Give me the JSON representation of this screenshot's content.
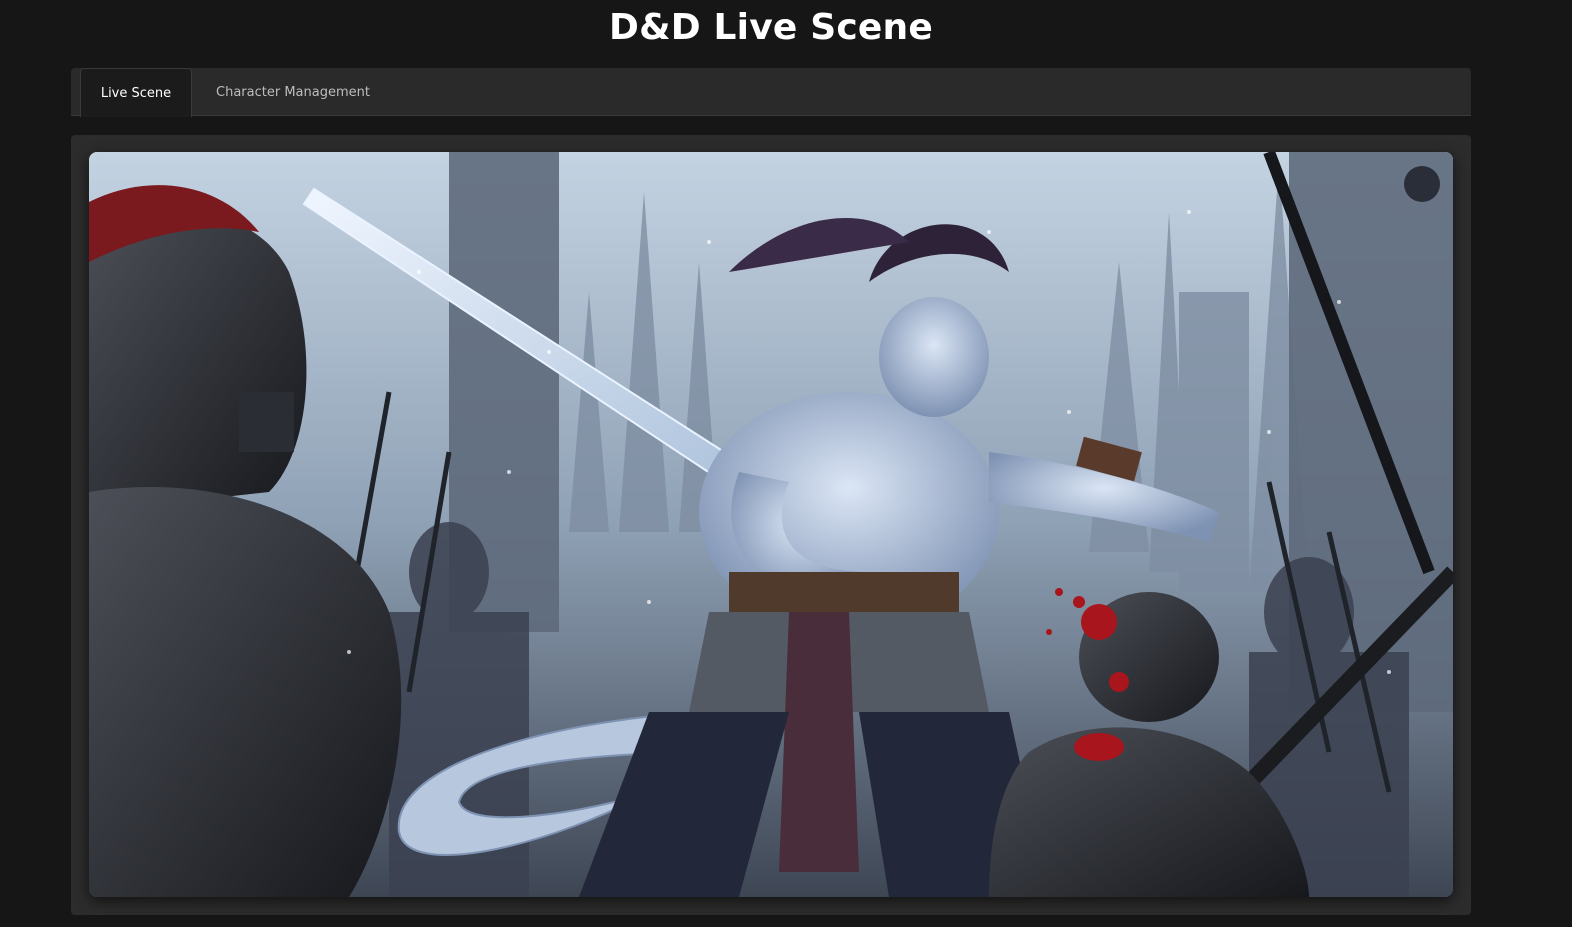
{
  "app": {
    "title": "D&D Live Scene"
  },
  "tabs": [
    {
      "label": "Live Scene",
      "active": true
    },
    {
      "label": "Character Management",
      "active": false
    }
  ],
  "scene": {
    "image_subject": "ice dragonborn warrior with frost sword battling armored soldiers in a ruined city",
    "corner_button_icon": "circle-button-icon"
  },
  "colors": {
    "background": "#161616",
    "panel": "#2c2c2c",
    "tab_bar": "#2a2a2a",
    "active_tab": "#1b1b1b"
  }
}
